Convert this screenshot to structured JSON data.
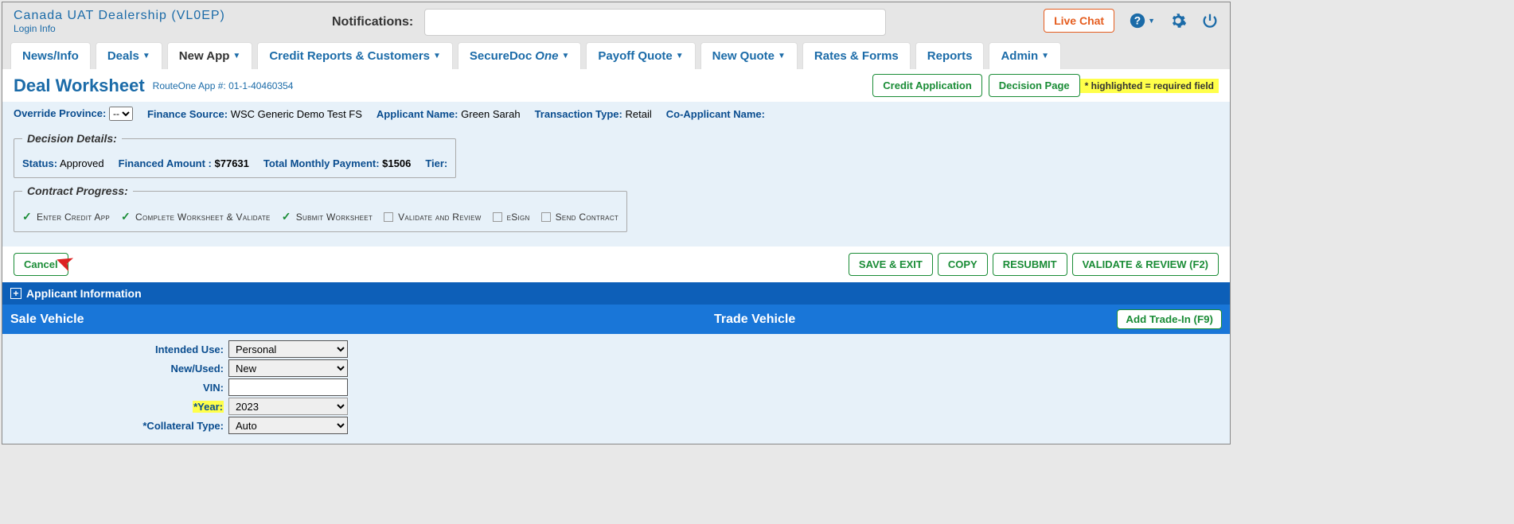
{
  "header": {
    "dealer_name": "Canada  UAT  Dealership  (VL0EP)",
    "login_label": "Login  Info",
    "notifications_label": "Notifications:",
    "live_chat_label": "Live Chat"
  },
  "tabs": [
    {
      "label": "News/Info",
      "dropdown": false
    },
    {
      "label": "Deals",
      "dropdown": true
    },
    {
      "label": "New App",
      "dropdown": true,
      "active": true
    },
    {
      "label": "Credit Reports & Customers",
      "dropdown": true
    },
    {
      "label": "SecureDocOne",
      "dropdown": true,
      "italic_one": true
    },
    {
      "label": "Payoff Quote",
      "dropdown": true
    },
    {
      "label": "New Quote",
      "dropdown": true
    },
    {
      "label": "Rates & Forms",
      "dropdown": false
    },
    {
      "label": "Reports",
      "dropdown": false
    },
    {
      "label": "Admin",
      "dropdown": true
    }
  ],
  "page": {
    "title": "Deal Worksheet",
    "app_number_label": "RouteOne App #: ",
    "app_number": "01-1-40460354",
    "credit_app_btn": "Credit Application",
    "decision_page_btn": "Decision Page",
    "required_note": "* highlighted = required field"
  },
  "meta": {
    "override_province_label": "Override Province:",
    "override_province_value": "--",
    "finance_source_label": "Finance Source:",
    "finance_source_value": "WSC Generic Demo Test FS",
    "applicant_name_label": "Applicant Name:",
    "applicant_name_value": "Green Sarah",
    "transaction_type_label": "Transaction Type:",
    "transaction_type_value": "Retail",
    "co_applicant_label": "Co-Applicant Name:",
    "co_applicant_value": ""
  },
  "decision_details": {
    "legend": "Decision Details:",
    "status_label": "Status:",
    "status_value": "Approved",
    "financed_label": "Financed Amount :",
    "financed_value": "$77631",
    "monthly_label": "Total Monthly Payment:",
    "monthly_value": "$1506",
    "tier_label": "Tier:",
    "tier_value": ""
  },
  "contract_progress": {
    "legend": "Contract Progress:",
    "steps": [
      {
        "label": "Enter Credit App",
        "done": true
      },
      {
        "label": "Complete Worksheet & Validate",
        "done": true
      },
      {
        "label": "Submit Worksheet",
        "done": true
      },
      {
        "label": "Validate and Review",
        "done": false
      },
      {
        "label": "eSign",
        "done": false
      },
      {
        "label": "Send Contract",
        "done": false
      }
    ]
  },
  "actions": {
    "cancel": "Cancel",
    "save_exit": "SAVE & EXIT",
    "copy": "COPY",
    "resubmit": "RESUBMIT",
    "validate_review": "VALIDATE & REVIEW (F2)"
  },
  "sections": {
    "applicant_info": "Applicant Information",
    "sale_vehicle": "Sale Vehicle",
    "trade_vehicle": "Trade Vehicle",
    "add_trade_in": "Add Trade-In (F9)"
  },
  "vehicle_form": {
    "intended_use_label": "Intended Use:",
    "intended_use_value": "Personal",
    "new_used_label": "New/Used:",
    "new_used_value": "New",
    "vin_label": "VIN:",
    "vin_value": "",
    "year_label": "*Year:",
    "year_value": "2023",
    "collateral_label": "*Collateral Type:",
    "collateral_value": "Auto"
  }
}
